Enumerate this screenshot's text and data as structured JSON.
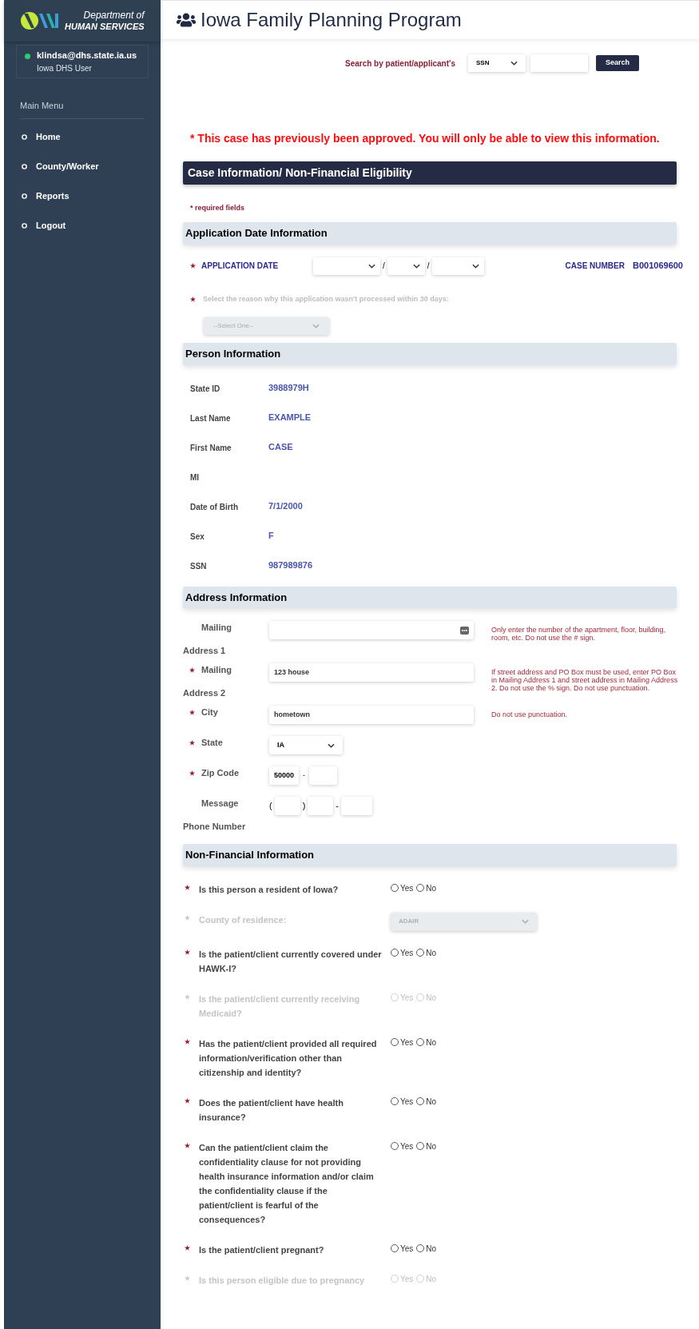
{
  "sidebar": {
    "logo": {
      "line_1": "Department of",
      "line_2": "HUMAN SERVICES"
    },
    "user": {
      "email": "klindsa@dhs.state.ia.us",
      "role": "Iowa DHS User",
      "online": true
    },
    "menu_title": "Main Menu",
    "items": [
      {
        "label": "Home"
      },
      {
        "label": "County/Worker"
      },
      {
        "label": "Reports"
      },
      {
        "label": "Logout"
      }
    ]
  },
  "header": {
    "title": "Iowa Family Planning Program"
  },
  "search": {
    "label": "Search by patient/applicant's",
    "type_value": "SSN",
    "button": "Search"
  },
  "warning": "* This case has previously been approved. You will only be able to view this information.",
  "case_bar": "Case Information/ Non-Financial Eligibility",
  "required_note": "* required fields",
  "application": {
    "title": "Application Date Information",
    "date_label": "APPLICATION DATE",
    "separators": [
      "/",
      "/"
    ],
    "case_number_label": "CASE NUMBER",
    "case_number": "B001069600",
    "reason": {
      "label": "Select the reason why this application wasn't processed within 30 days:",
      "value": "--Select One--",
      "disabled": true
    }
  },
  "person": {
    "title": "Person Information",
    "fields": [
      {
        "label": "State ID",
        "value": "3988979H"
      },
      {
        "label": "Last Name",
        "value": "EXAMPLE"
      },
      {
        "label": "First Name",
        "value": "CASE"
      },
      {
        "label": "MI"
      },
      {
        "label": "Date of Birth",
        "value": "7/1/2000"
      },
      {
        "label": "Sex",
        "value": "F"
      },
      {
        "label": "SSN",
        "value": "987989876"
      }
    ]
  },
  "address": {
    "title": "Address Information",
    "fields": [
      {
        "kind": "text",
        "label_1": "Mailing",
        "label_2": "Address 1",
        "required": false,
        "hint": "Only enter the number of the apartment, floor, building, room, etc. Do not use the # sign."
      },
      {
        "kind": "text",
        "label_1": "Mailing",
        "label_2": "Address 2",
        "required": true,
        "value": "123 house",
        "hint": "If street address and PO Box must be used, enter PO Box in Mailing Address 1 and street address in Mailing Address 2. Do not use the % sign. Do not use punctuation."
      },
      {
        "kind": "text",
        "label_1": "City",
        "required": true,
        "value": "hometown",
        "hint": "Do not use punctuation."
      },
      {
        "kind": "select",
        "label_1": "State",
        "required": true,
        "value": "IA"
      },
      {
        "kind": "zip",
        "label_1": "Zip Code",
        "required": true,
        "value": "50000",
        "separator": "-"
      },
      {
        "kind": "phone",
        "label_1": "Message",
        "label_2": "Phone Number",
        "required": false,
        "separators": [
          "(",
          ")",
          "-"
        ]
      }
    ]
  },
  "non_financial": {
    "title": "Non-Financial Information",
    "questions": [
      {
        "kind": "radio",
        "text": "Is this person a resident of Iowa?",
        "disabled": false,
        "options": [
          "Yes",
          "No"
        ]
      },
      {
        "kind": "select",
        "text": "County of residence:",
        "disabled": true,
        "value": "ADAIR"
      },
      {
        "kind": "radio",
        "text": "Is the patient/client currently covered under HAWK-I?",
        "disabled": false,
        "options": [
          "Yes",
          "No"
        ]
      },
      {
        "kind": "radio",
        "text": "Is the patient/client currently receiving Medicaid?",
        "disabled": true,
        "options": [
          "Yes",
          "No"
        ]
      },
      {
        "kind": "radio",
        "text": "Has the patient/client provided all required information/verification other than citizenship and identity?",
        "disabled": false,
        "options": [
          "Yes",
          "No"
        ]
      },
      {
        "kind": "radio",
        "text": "Does the patient/client have health insurance?",
        "disabled": false,
        "options": [
          "Yes",
          "No"
        ]
      },
      {
        "kind": "radio",
        "text": "Can the patient/client claim the confidentiality clause for not providing health insurance information and/or claim the confidentiality clause if the patient/client is fearful of the consequences?",
        "disabled": false,
        "options": [
          "Yes",
          "No"
        ]
      },
      {
        "kind": "radio",
        "text": "Is the patient/client pregnant?",
        "disabled": false,
        "options": [
          "Yes",
          "No"
        ]
      },
      {
        "kind": "radio",
        "text": "Is this person eligible due to pregnancy",
        "disabled": true,
        "options": [
          "Yes",
          "No"
        ]
      }
    ]
  }
}
